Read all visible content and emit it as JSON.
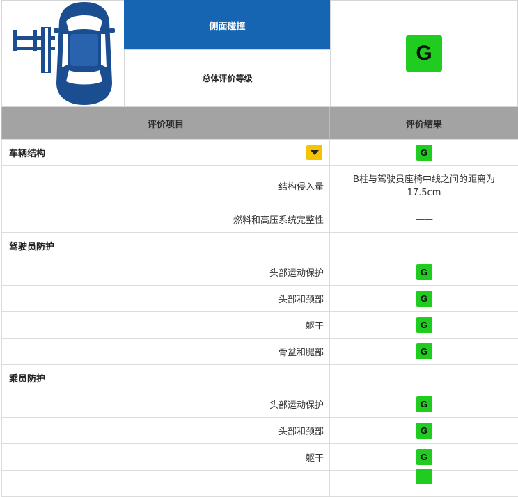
{
  "header": {
    "title": "侧面碰撞",
    "overall_label": "总体评价等级",
    "overall_grade": "G"
  },
  "table": {
    "columns": [
      "评价项目",
      "评价结果"
    ],
    "sections": [
      {
        "name": "车辆结构",
        "grade": "G",
        "items": [
          {
            "label": "结构侵入量",
            "result": "B柱与驾驶员座椅中线之间的距离为17.5cm"
          },
          {
            "label": "燃料和高压系统完整性",
            "result": "——"
          }
        ]
      },
      {
        "name": "驾驶员防护",
        "grade": "",
        "items": [
          {
            "label": "头部运动保护",
            "result": "G"
          },
          {
            "label": "头部和颈部",
            "result": "G"
          },
          {
            "label": "躯干",
            "result": "G"
          },
          {
            "label": "骨盆和腿部",
            "result": "G"
          }
        ]
      },
      {
        "name": "乘员防护",
        "grade": "",
        "items": [
          {
            "label": "头部运动保护",
            "result": "G"
          },
          {
            "label": "头部和颈部",
            "result": "G"
          },
          {
            "label": "躯干",
            "result": "G"
          }
        ]
      }
    ]
  },
  "colors": {
    "header_blue": "#1565b2",
    "grade_green": "#1fcc1f",
    "dropdown_yellow": "#f5c400",
    "car_blue": "#1b4d91"
  }
}
